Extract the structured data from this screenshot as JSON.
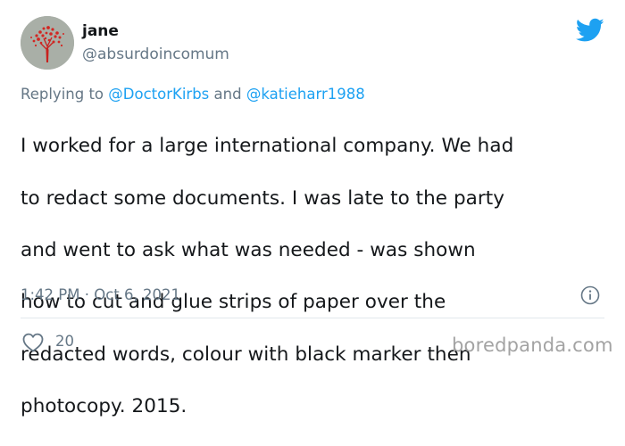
{
  "user": {
    "display_name": "jane",
    "handle": "@absurdoincomum",
    "avatar_icon": "red-tree-avatar"
  },
  "reply": {
    "prefix": "Replying to ",
    "mention1": "@DoctorKirbs",
    "conjunction": " and ",
    "mention2": "@katieharr1988"
  },
  "tweet": {
    "lines": [
      "I worked for a large international company. We had",
      "to redact some documents. I was late to the party",
      "and went to ask what was needed - was shown",
      "how to cut and glue strips of paper over the",
      "redacted words, colour with black marker then",
      "photocopy. 2015."
    ],
    "timestamp": "1:42 PM · Oct 6, 2021"
  },
  "engagement": {
    "likes": "20",
    "like_icon": "heart-icon"
  },
  "header_icon": "twitter-bird-icon",
  "info_icon": "info-icon",
  "watermark": "boredpanda.com",
  "colors": {
    "twitter_blue": "#1da1f2",
    "text_primary": "#14171a",
    "text_secondary": "#657786",
    "divider": "#e1e8ed",
    "watermark": "#a3a3a3"
  }
}
